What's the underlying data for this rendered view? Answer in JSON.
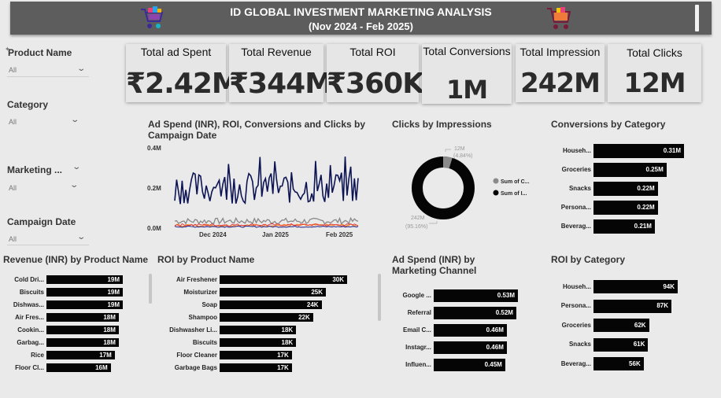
{
  "header": {
    "title": "ID GLOBAL INVESTMENT MARKETING ANALYSIS",
    "subtitle": "(Nov 2024 - Feb 2025)"
  },
  "filters": [
    {
      "label": "Product Name",
      "value": "All"
    },
    {
      "label": "Category",
      "value": "All"
    },
    {
      "label": "Marketing ...",
      "value": "All"
    },
    {
      "label": "Campaign Date",
      "value": "All"
    }
  ],
  "kpis": [
    {
      "label": "Total ad Spent",
      "value": "₹2.42M"
    },
    {
      "label": "Total Revenue",
      "value": "₹344M"
    },
    {
      "label": "Total ROI",
      "value": "₹360K"
    },
    {
      "label": "Total Conversions",
      "value": "1M"
    },
    {
      "label": "Total Impression",
      "value": "242M"
    },
    {
      "label": "Total Clicks",
      "value": "12M"
    }
  ],
  "line_chart": {
    "title": "Ad Spend (INR), ROI, Conversions and Clicks by Campaign Date",
    "y_ticks": [
      "0.4M",
      "0.2M",
      "0.0M"
    ],
    "x_ticks": [
      "Dec 2024",
      "Jan 2025",
      "Feb 2025"
    ],
    "colors": {
      "ad_spend": "#f58220",
      "roi": "#2e3192",
      "conversions": "#888888",
      "clicks": "#0d1453",
      "extra": "#e03c3c"
    }
  },
  "donut": {
    "title": "Clicks by Impressions",
    "small_label": "12M",
    "small_pct": "(4.84%)",
    "large_label": "242M",
    "large_pct": "(95.16%)",
    "legend": [
      "Sum of C...",
      "Sum of I..."
    ],
    "colors": {
      "clicks": "#8a8a8a",
      "impressions": "#050505"
    }
  },
  "conv_by_cat": {
    "title": "Conversions by Category",
    "items": [
      {
        "label": "Househ...",
        "value": "0.31M",
        "v": 0.31
      },
      {
        "label": "Groceries",
        "value": "0.25M",
        "v": 0.25
      },
      {
        "label": "Snacks",
        "value": "0.22M",
        "v": 0.22
      },
      {
        "label": "Persona...",
        "value": "0.22M",
        "v": 0.22
      },
      {
        "label": "Beverag...",
        "value": "0.21M",
        "v": 0.21
      }
    ]
  },
  "rev_by_product": {
    "title": "Revenue (INR) by Product Name",
    "items": [
      {
        "label": "Cold Dri...",
        "value": "19M",
        "v": 19
      },
      {
        "label": "Biscuits",
        "value": "19M",
        "v": 19
      },
      {
        "label": "Dishwas...",
        "value": "19M",
        "v": 19
      },
      {
        "label": "Air Fres...",
        "value": "18M",
        "v": 18
      },
      {
        "label": "Cookin...",
        "value": "18M",
        "v": 18
      },
      {
        "label": "Garbag...",
        "value": "18M",
        "v": 18
      },
      {
        "label": "Rice",
        "value": "17M",
        "v": 17
      },
      {
        "label": "Floor Cl...",
        "value": "16M",
        "v": 16
      }
    ]
  },
  "roi_by_product": {
    "title": "ROI by Product Name",
    "items": [
      {
        "label": "Air Freshener",
        "value": "30K",
        "v": 30
      },
      {
        "label": "Moisturizer",
        "value": "25K",
        "v": 25
      },
      {
        "label": "Soap",
        "value": "24K",
        "v": 24
      },
      {
        "label": "Shampoo",
        "value": "22K",
        "v": 22
      },
      {
        "label": "Dishwasher Li...",
        "value": "18K",
        "v": 18
      },
      {
        "label": "Biscuits",
        "value": "18K",
        "v": 18
      },
      {
        "label": "Floor Cleaner",
        "value": "17K",
        "v": 17
      },
      {
        "label": "Garbage Bags",
        "value": "17K",
        "v": 17
      }
    ]
  },
  "spend_by_channel": {
    "title": "Ad Spend (INR) by Marketing Channel",
    "items": [
      {
        "label": "Google ...",
        "value": "0.53M",
        "v": 0.53
      },
      {
        "label": "Referral",
        "value": "0.52M",
        "v": 0.52
      },
      {
        "label": "Email C...",
        "value": "0.46M",
        "v": 0.46
      },
      {
        "label": "Instagr...",
        "value": "0.46M",
        "v": 0.46
      },
      {
        "label": "Influen...",
        "value": "0.45M",
        "v": 0.45
      }
    ]
  },
  "roi_by_cat": {
    "title": "ROI by Category",
    "items": [
      {
        "label": "Househ...",
        "value": "94K",
        "v": 94
      },
      {
        "label": "Persona...",
        "value": "87K",
        "v": 87
      },
      {
        "label": "Groceries",
        "value": "62K",
        "v": 62
      },
      {
        "label": "Snacks",
        "value": "61K",
        "v": 61
      },
      {
        "label": "Beverag...",
        "value": "56K",
        "v": 56
      }
    ]
  }
}
